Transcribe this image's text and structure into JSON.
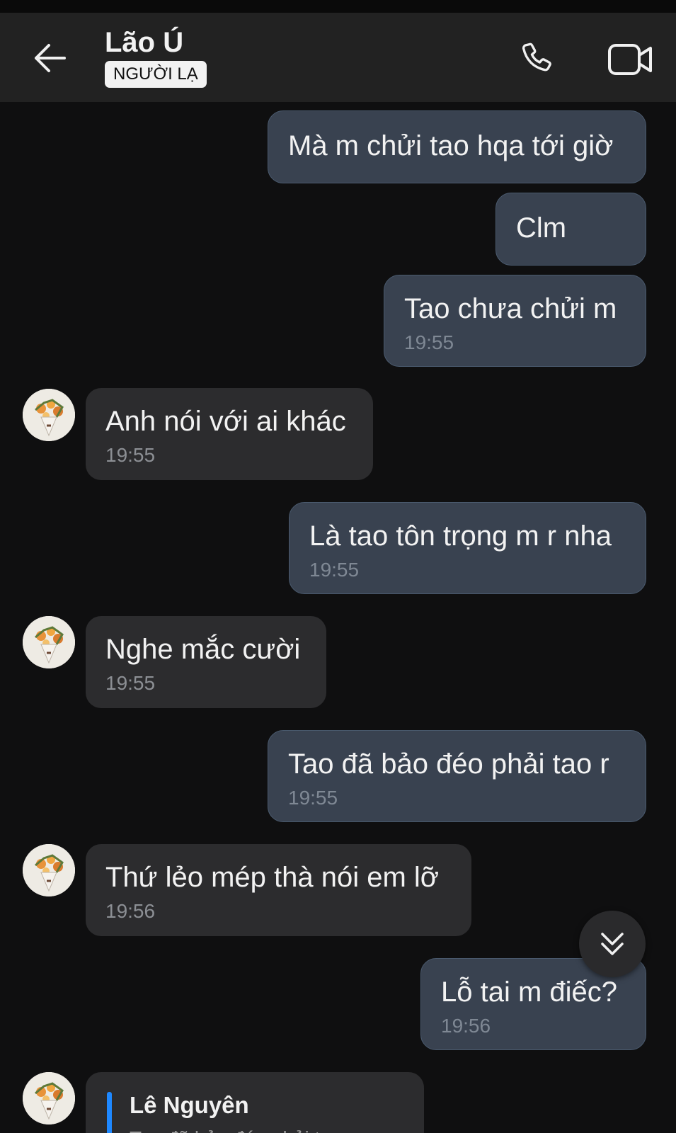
{
  "header": {
    "title": "Lão Ú",
    "badge": "NGƯỜI LẠ"
  },
  "messages": [
    {
      "dir": "out",
      "text": "Mà m chửi tao hqa tới giờ",
      "time": ""
    },
    {
      "dir": "out",
      "text": "Clm",
      "time": ""
    },
    {
      "dir": "out",
      "text": "Tao chưa chửi m",
      "time": "19:55"
    },
    {
      "dir": "in",
      "text": "Anh nói với ai khác",
      "time": "19:55"
    },
    {
      "dir": "out",
      "text": "Là tao tôn trọng m r nha",
      "time": "19:55"
    },
    {
      "dir": "in",
      "text": "Nghe mắc cười",
      "time": "19:55"
    },
    {
      "dir": "out",
      "text": "Tao đã bảo đéo phải tao r",
      "time": "19:55"
    },
    {
      "dir": "in",
      "text": "Thứ lẻo mép thà nói em lỡ",
      "time": "19:56"
    },
    {
      "dir": "out",
      "text": "Lỗ tai m điếc?",
      "time": "19:56"
    }
  ],
  "reply": {
    "quoted_name": "Lê Nguyên",
    "quoted_preview": "Tao đã bảo đéo phải tao r"
  },
  "colors": {
    "outgoing_bubble": "#394250",
    "incoming_bubble": "#2c2c2e",
    "header_bg": "#222222",
    "quote_accent": "#1e88ff"
  },
  "icons": [
    "back-arrow-icon",
    "phone-icon",
    "video-camera-icon",
    "chevron-double-down-icon",
    "avatar-bouquet-icon"
  ]
}
